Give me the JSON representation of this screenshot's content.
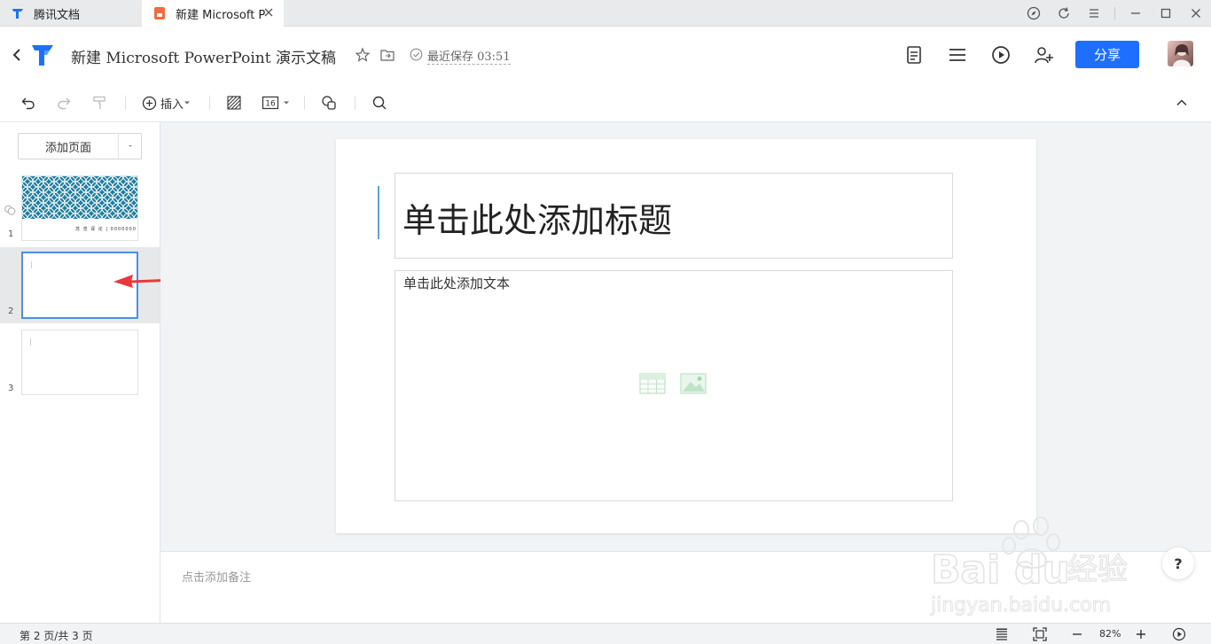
{
  "browser": {
    "tabs": [
      {
        "label": "腾讯文档",
        "icon": "tencent-docs-icon"
      },
      {
        "label": "新建 Microsoft P",
        "icon": "slides-file-icon",
        "active": true
      }
    ],
    "window_controls": [
      "compass-icon",
      "refresh-icon",
      "menu-icon",
      "minimize-icon",
      "maximize-icon",
      "close-icon"
    ]
  },
  "header": {
    "title": "新建 Microsoft PowerPoint 演示文稿",
    "save_status": "最近保存 03:51",
    "share_label": "分享",
    "actions": [
      "notes-icon",
      "list-icon",
      "play-icon",
      "add-collaborator-icon"
    ]
  },
  "toolbar": {
    "insert_label": "插入",
    "font_size_value": "16"
  },
  "sidebar": {
    "add_page_label": "添加页面",
    "slides": [
      {
        "number": "1",
        "caption": "苏 览 译 论 | 0000000"
      },
      {
        "number": "2"
      },
      {
        "number": "3"
      }
    ]
  },
  "slide": {
    "title_placeholder": "单击此处添加标题",
    "body_placeholder": "单击此处添加文本"
  },
  "notes": {
    "placeholder": "点击添加备注"
  },
  "help": {
    "label": "?"
  },
  "status": {
    "page_info": "第 2 页/共 3 页",
    "zoom": "82%"
  },
  "colors": {
    "accent": "#1e6fff",
    "selection": "#4a90e2",
    "thumb_pattern": "#1f7d9e",
    "annotation_arrow": "#e8383d"
  }
}
